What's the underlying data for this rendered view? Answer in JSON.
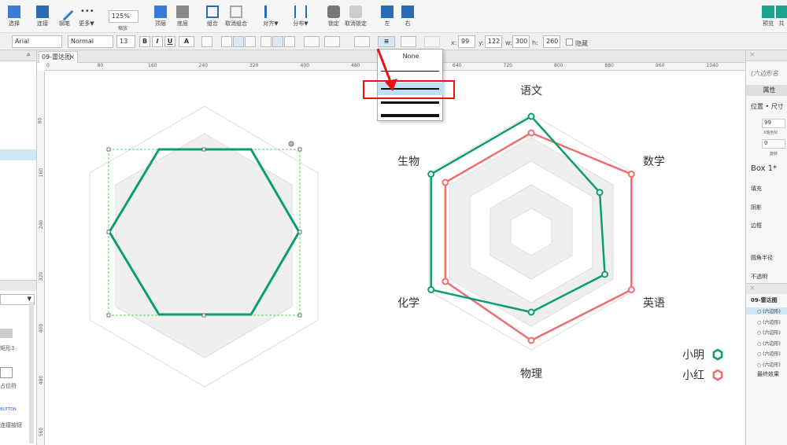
{
  "toolbar": {
    "buttons": [
      "选择",
      "连接",
      "钢笔",
      "更多▼",
      "缩放",
      "顶层",
      "底层",
      "组合",
      "取消组合",
      "对齐▼",
      "分布▼",
      "锁定",
      "取消锁定",
      "左",
      "右",
      "预览",
      "共"
    ],
    "zoom": "125%"
  },
  "format_bar": {
    "font": "Arial",
    "style": "Normal",
    "size": "13",
    "bold": "B",
    "italic": "I",
    "underline": "U",
    "font_color": "A",
    "x_label": "x:",
    "x": "99",
    "y_label": "y:",
    "y": "122",
    "w_label": "w:",
    "w": "300",
    "h_label": "h:",
    "h": "260",
    "hide_label": "隐藏"
  },
  "tab": {
    "title": "09-雷达图",
    "close": "×"
  },
  "ruler_h": [
    "0",
    "80",
    "160",
    "240",
    "320",
    "400",
    "480",
    "560",
    "640",
    "720",
    "800",
    "880",
    "960",
    "1040"
  ],
  "ruler_v": [
    "80",
    "160",
    "240",
    "320",
    "400",
    "480",
    "560"
  ],
  "dropdown": {
    "none_label": "None"
  },
  "chart_data": {
    "type": "radar",
    "axes": [
      "语文",
      "数学",
      "英语",
      "物理",
      "化学",
      "生物"
    ],
    "series": [
      {
        "name": "小明",
        "color": "#0e9e6e",
        "values": [
          0.98,
          0.67,
          0.72,
          0.68,
          0.98,
          0.98
        ]
      },
      {
        "name": "小红",
        "color": "#f06e6e",
        "values": [
          0.84,
          0.98,
          0.98,
          0.92,
          0.84,
          0.84
        ]
      }
    ],
    "legend_position": "bottom-right"
  },
  "left_panel": {
    "rect_label": "矩形3",
    "placeholder_label": "占位符",
    "button_label": "BUTTON",
    "link_button_label": "连接按钮"
  },
  "right_panel": {
    "shape_name": "(六边形名",
    "props_tab": "属性",
    "pos_size": "位置 • 尺寸",
    "x_value": "99",
    "x_axis_label": "X轴坐标",
    "rotation_value": "0",
    "rotation_label": "旋转",
    "widget_name": "Box 1*",
    "fill": "填充",
    "shadow": "阴影",
    "border": "边框",
    "radius": "圆角半径",
    "opacity": "不透明",
    "page_name": "09-雷达图",
    "layer_items": [
      "(六边形)",
      "(六边形)",
      "(六边形)",
      "(六边形)",
      "(六边形)",
      "(六边形)"
    ],
    "folder": "最终效果"
  },
  "colors": {
    "accent": "#1e88e5",
    "selection": "#5ad35a",
    "red_highlight": "#e11"
  }
}
